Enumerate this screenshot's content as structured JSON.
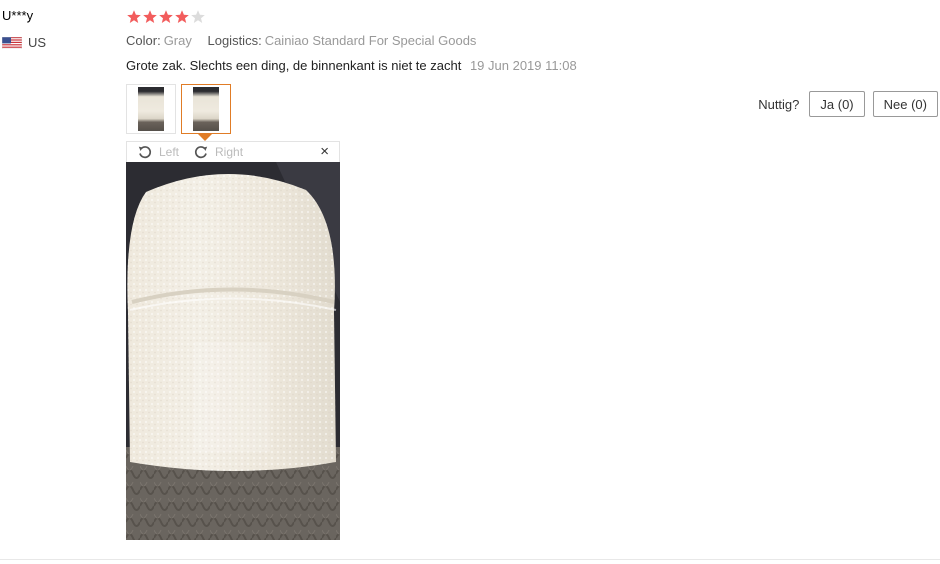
{
  "user": {
    "name": "U***y",
    "country": "US",
    "flag_icon": "us-flag-icon"
  },
  "rating": {
    "value": 4,
    "max": 5,
    "filled_color": "#f25c5c",
    "empty_color": "#dcdcdc"
  },
  "attributes": [
    {
      "key": "Color:",
      "value": "Gray"
    },
    {
      "key": "Logistics:",
      "value": "Cainiao Standard For Special Goods"
    }
  ],
  "comment": {
    "text": "Grote zak. Slechts een ding, de binnenkant is niet te zacht",
    "date": "19 Jun 2019 11:08"
  },
  "thumbnails": [
    {
      "icon": "photo-thumbnail",
      "active": false
    },
    {
      "icon": "photo-thumbnail",
      "active": true
    }
  ],
  "viewer": {
    "rotate_left_label": "Left",
    "rotate_right_label": "Right",
    "close_symbol": "×",
    "accent_color": "#e07c26"
  },
  "helpful": {
    "label": "Nuttig?",
    "yes_label": "Ja (0)",
    "no_label": "Nee (0)"
  }
}
